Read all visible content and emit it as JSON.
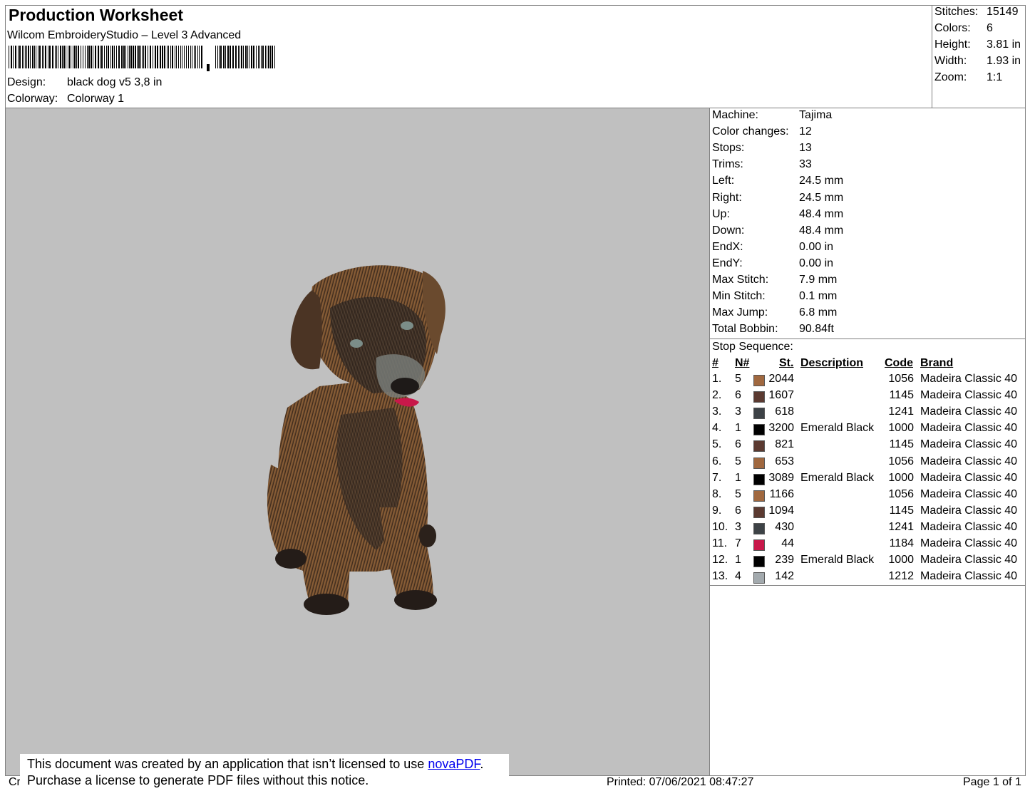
{
  "header": {
    "title": "Production Worksheet",
    "software": "Wilcom EmbroideryStudio – Level 3 Advanced",
    "design_label": "Design:",
    "design_value": "black dog v5 3,8 in",
    "colorway_label": "Colorway:",
    "colorway_value": "Colorway 1"
  },
  "stats": [
    {
      "label": "Stitches:",
      "value": "15149"
    },
    {
      "label": "Colors:",
      "value": "6"
    },
    {
      "label": "Height:",
      "value": "3.81 in"
    },
    {
      "label": "Width:",
      "value": "1.93 in"
    },
    {
      "label": "Zoom:",
      "value": "1:1"
    }
  ],
  "machine_info": [
    {
      "label": "Machine:",
      "value": "Tajima"
    },
    {
      "label": "Color changes:",
      "value": "12"
    },
    {
      "label": "Stops:",
      "value": "13"
    },
    {
      "label": "Trims:",
      "value": "33"
    },
    {
      "label": "Left:",
      "value": "24.5 mm"
    },
    {
      "label": "Right:",
      "value": "24.5 mm"
    },
    {
      "label": "Up:",
      "value": "48.4 mm"
    },
    {
      "label": "Down:",
      "value": "48.4 mm"
    },
    {
      "label": "EndX:",
      "value": "0.00 in"
    },
    {
      "label": "EndY:",
      "value": "0.00 in"
    },
    {
      "label": "Max Stitch:",
      "value": "7.9 mm"
    },
    {
      "label": "Min Stitch:",
      "value": "0.1 mm"
    },
    {
      "label": "Max Jump:",
      "value": "6.8 mm"
    },
    {
      "label": "Total Bobbin:",
      "value": "90.84ft"
    }
  ],
  "stop_sequence": {
    "title": "Stop Sequence:",
    "headers": {
      "num": "#",
      "needle": "N#",
      "stitches": "St.",
      "description": "Description",
      "code": "Code",
      "brand": "Brand"
    },
    "rows": [
      {
        "num": "1.",
        "needle": "5",
        "color": "#a0683f",
        "stitches": "2044",
        "description": "",
        "code": "1056",
        "brand": "Madeira Classic 40"
      },
      {
        "num": "2.",
        "needle": "6",
        "color": "#5b3a31",
        "stitches": "1607",
        "description": "",
        "code": "1145",
        "brand": "Madeira Classic 40"
      },
      {
        "num": "3.",
        "needle": "3",
        "color": "#3d4246",
        "stitches": "618",
        "description": "",
        "code": "1241",
        "brand": "Madeira Classic 40"
      },
      {
        "num": "4.",
        "needle": "1",
        "color": "#000000",
        "stitches": "3200",
        "description": "Emerald Black",
        "code": "1000",
        "brand": "Madeira Classic 40"
      },
      {
        "num": "5.",
        "needle": "6",
        "color": "#5b3a31",
        "stitches": "821",
        "description": "",
        "code": "1145",
        "brand": "Madeira Classic 40"
      },
      {
        "num": "6.",
        "needle": "5",
        "color": "#a0683f",
        "stitches": "653",
        "description": "",
        "code": "1056",
        "brand": "Madeira Classic 40"
      },
      {
        "num": "7.",
        "needle": "1",
        "color": "#000000",
        "stitches": "3089",
        "description": "Emerald Black",
        "code": "1000",
        "brand": "Madeira Classic 40"
      },
      {
        "num": "8.",
        "needle": "5",
        "color": "#a0683f",
        "stitches": "1166",
        "description": "",
        "code": "1056",
        "brand": "Madeira Classic 40"
      },
      {
        "num": "9.",
        "needle": "6",
        "color": "#5b3a31",
        "stitches": "1094",
        "description": "",
        "code": "1145",
        "brand": "Madeira Classic 40"
      },
      {
        "num": "10.",
        "needle": "3",
        "color": "#3d4246",
        "stitches": "430",
        "description": "",
        "code": "1241",
        "brand": "Madeira Classic 40"
      },
      {
        "num": "11.",
        "needle": "7",
        "color": "#c8184a",
        "stitches": "44",
        "description": "",
        "code": "1184",
        "brand": "Madeira Classic 40"
      },
      {
        "num": "12.",
        "needle": "1",
        "color": "#000000",
        "stitches": "239",
        "description": "Emerald Black",
        "code": "1000",
        "brand": "Madeira Classic 40"
      },
      {
        "num": "13.",
        "needle": "4",
        "color": "#a3aaae",
        "stitches": "142",
        "description": "",
        "code": "1212",
        "brand": "Madeira Classic 40"
      }
    ]
  },
  "footer": {
    "notice_line1": "This document was created by an application that isn’t licensed to use ",
    "notice_link": "novaPDF",
    "notice_period": ".",
    "notice_line2": "Purchase a license to generate PDF files without this notice.",
    "cr_text": "Cr",
    "printed": "Printed: 07/06/2021 08:47:27",
    "page": "Page 1 of 1"
  }
}
